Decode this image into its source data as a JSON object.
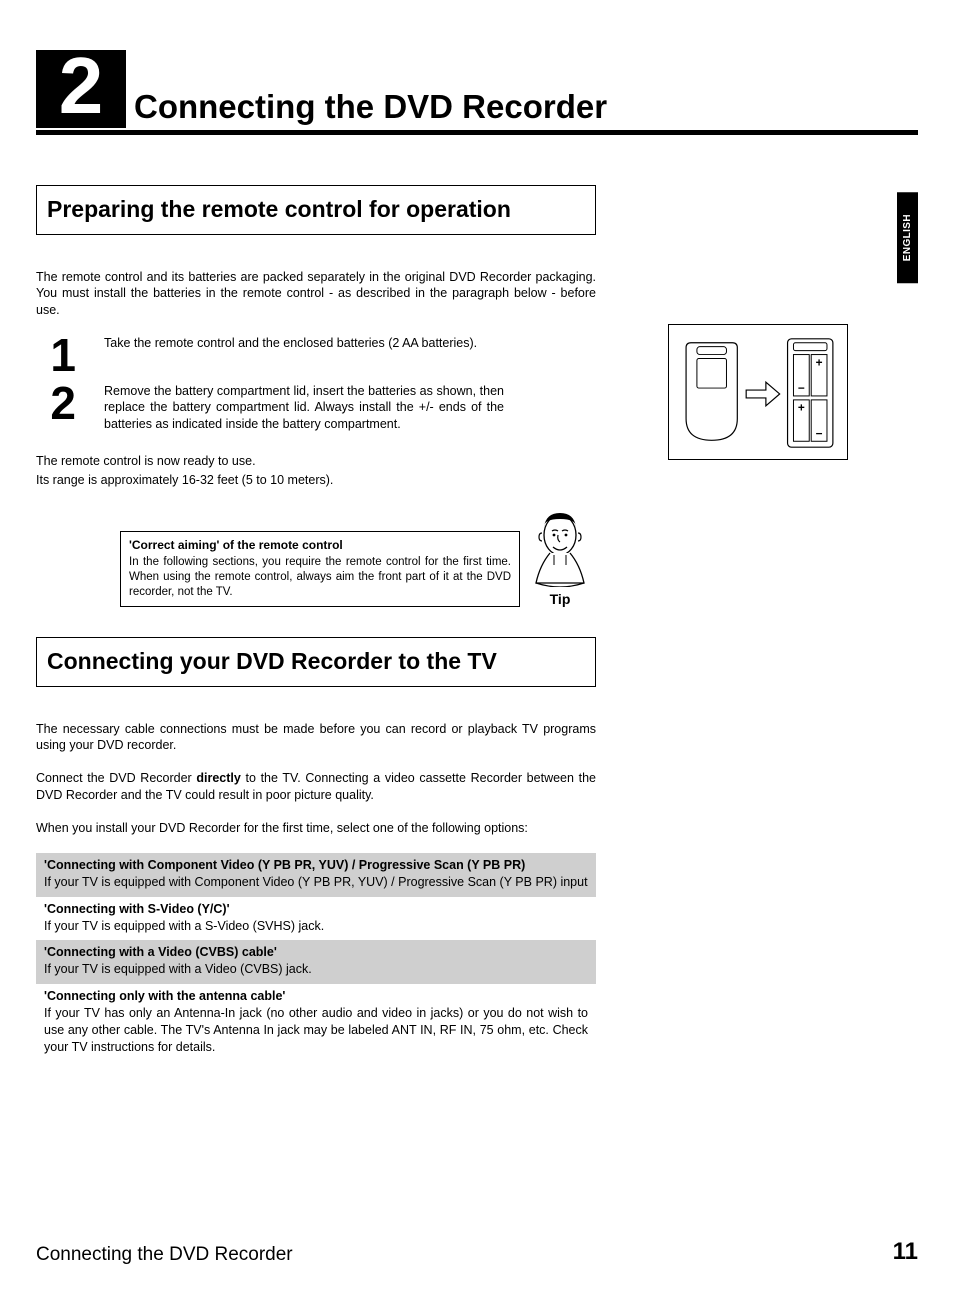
{
  "chapter": {
    "number": "2",
    "title": "Connecting the DVD Recorder"
  },
  "language_tab": "ENGLISH",
  "section1": {
    "heading": "Preparing the remote control for operation",
    "intro": "The remote control and its batteries are packed separately in the original DVD Recorder packaging. You must install the batteries in the remote control - as described in the paragraph below - before use.",
    "steps": [
      {
        "n": "1",
        "text": "Take the remote control and the enclosed batteries (2 AA batteries)."
      },
      {
        "n": "2",
        "text": "Remove the battery compartment lid, insert the batteries as shown, then replace the battery compartment lid. Always install the +/- ends of the batteries as indicated inside the battery compartment."
      }
    ],
    "ready_line1": "The remote control is now ready to use.",
    "ready_line2": "Its range is approximately 16-32 feet (5 to 10 meters).",
    "tip": {
      "title": "'Correct aiming' of the remote control",
      "text": "In the following sections, you require the remote control for the first time. When using the remote control, always aim the front part of it at the DVD recorder, not the TV.",
      "label": "Tip"
    }
  },
  "section2": {
    "heading": "Connecting your DVD Recorder to the TV",
    "p1": "The necessary cable connections must be made before you can record or playback TV programs using your DVD recorder.",
    "p2_pre": "Connect the DVD Recorder ",
    "p2_bold": "directly",
    "p2_post": " to the TV. Connecting a video cassette Recorder between the DVD Recorder and the TV could result in poor picture quality.",
    "p3": "When you install your DVD Recorder for the first time, select one of the following options:",
    "options": [
      {
        "title": "'Connecting with Component Video (Y PB PR, YUV) / Progressive Scan (Y PB PR)",
        "desc": "If your TV is equipped with Component Video (Y PB PR, YUV) / Progressive Scan (Y PB PR) input",
        "shaded": true
      },
      {
        "title": "'Connecting with S-Video (Y/C)'",
        "desc": "If your TV is equipped with a S-Video (SVHS) jack.",
        "shaded": false
      },
      {
        "title": "'Connecting with a Video (CVBS) cable'",
        "desc": "If your TV is equipped with a Video (CVBS) jack.",
        "shaded": true
      },
      {
        "title": "'Connecting only with the antenna cable'",
        "desc": "If your TV has only an Antenna-In jack (no other audio and video in jacks) or you do not wish to use any other cable. The TV's Antenna In jack may be labeled ANT IN, RF IN, 75 ohm, etc. Check your TV instructions for details.",
        "shaded": false
      }
    ]
  },
  "footer": {
    "title": "Connecting the DVD Recorder",
    "page": "11"
  }
}
